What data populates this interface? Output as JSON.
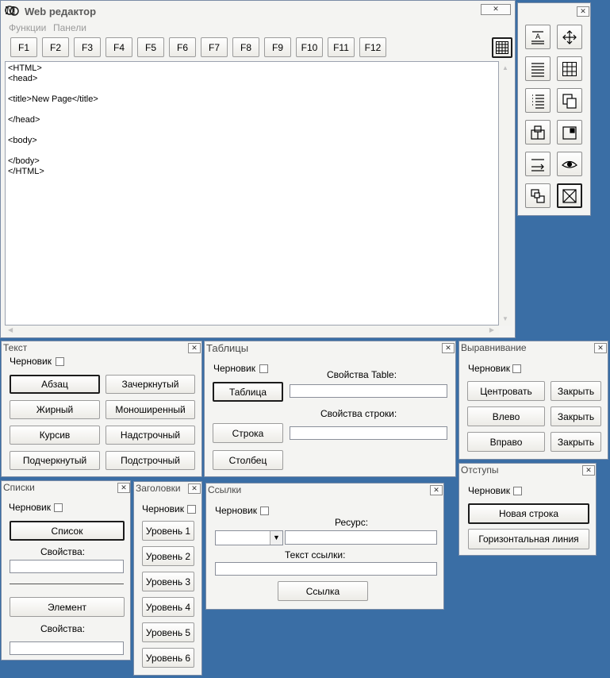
{
  "main": {
    "title": "Web редактор",
    "menu": [
      "Функции",
      "Панели"
    ],
    "fkeys": [
      "F1",
      "F2",
      "F3",
      "F4",
      "F5",
      "F6",
      "F7",
      "F8",
      "F9",
      "F10",
      "F11",
      "F12"
    ],
    "code": "<HTML>\n<head>\n\n<title>New Page</title>\n\n</head>\n\n<body>\n\n</body>\n</HTML>"
  },
  "text_panel": {
    "title": "Текст",
    "draft": "Черновик",
    "buttons": [
      "Абзац",
      "Зачеркнутый",
      "Жирный",
      "Моноширенный",
      "Курсив",
      "Надстрочный",
      "Подчеркнутый",
      "Подстрочный"
    ]
  },
  "tables_panel": {
    "title": "Таблицы",
    "draft": "Черновик",
    "table_props": "Свойства Table:",
    "row_props": "Свойства строки:",
    "table_btn": "Таблица",
    "row_btn": "Строка",
    "col_btn": "Столбец"
  },
  "align_panel": {
    "title": "Выравнивание",
    "draft": "Черновик",
    "center": "Центровать",
    "left": "Влево",
    "right": "Вправо",
    "close": "Закрыть"
  },
  "indent_panel": {
    "title": "Отступы",
    "draft": "Черновик",
    "newline": "Новая строка",
    "hr": "Горизонтальная линия"
  },
  "lists_panel": {
    "title": "Списки",
    "draft": "Черновик",
    "list_btn": "Список",
    "props": "Свойства:",
    "item_btn": "Элемент",
    "props2": "Свойства:"
  },
  "headings_panel": {
    "title": "Заголовки",
    "draft": "Черновик",
    "levels": [
      "Уровень 1",
      "Уровень 2",
      "Уровень 3",
      "Уровень 4",
      "Уровень 5",
      "Уровень 6"
    ]
  },
  "links_panel": {
    "title": "Ссылки",
    "draft": "Черновик",
    "resource": "Ресурс:",
    "link_text": "Текст ссылки:",
    "link_btn": "Ссылка"
  },
  "tools": [
    "text-format-icon",
    "move-icon",
    "paragraph-icon",
    "table-icon",
    "list-icon",
    "copy-icon",
    "components-icon",
    "grid-panel-icon",
    "arrow-line-icon",
    "eye-icon",
    "shapes-icon",
    "image-box-icon"
  ]
}
